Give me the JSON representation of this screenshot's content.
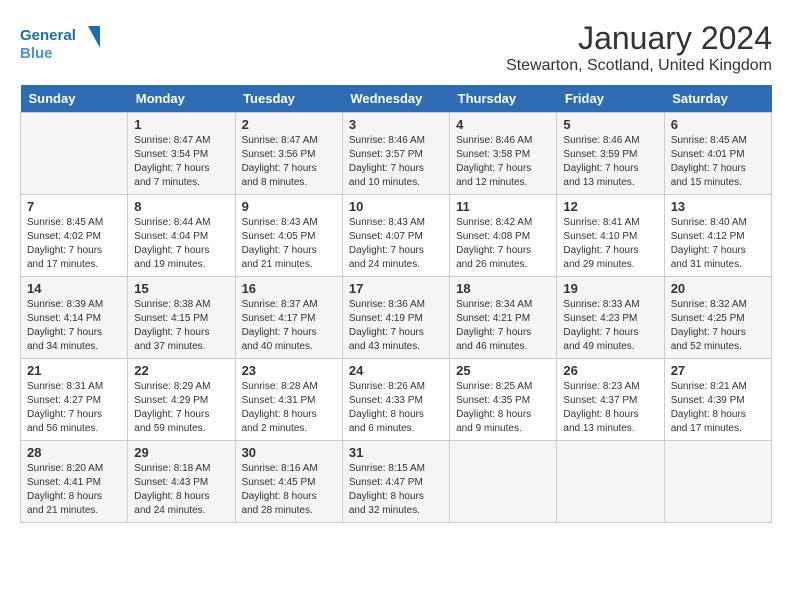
{
  "logo": {
    "line1": "General",
    "line2": "Blue"
  },
  "title": "January 2024",
  "location": "Stewarton, Scotland, United Kingdom",
  "days_of_week": [
    "Sunday",
    "Monday",
    "Tuesday",
    "Wednesday",
    "Thursday",
    "Friday",
    "Saturday"
  ],
  "weeks": [
    [
      {
        "day": "",
        "info": ""
      },
      {
        "day": "1",
        "info": "Sunrise: 8:47 AM\nSunset: 3:54 PM\nDaylight: 7 hours\nand 7 minutes."
      },
      {
        "day": "2",
        "info": "Sunrise: 8:47 AM\nSunset: 3:56 PM\nDaylight: 7 hours\nand 8 minutes."
      },
      {
        "day": "3",
        "info": "Sunrise: 8:46 AM\nSunset: 3:57 PM\nDaylight: 7 hours\nand 10 minutes."
      },
      {
        "day": "4",
        "info": "Sunrise: 8:46 AM\nSunset: 3:58 PM\nDaylight: 7 hours\nand 12 minutes."
      },
      {
        "day": "5",
        "info": "Sunrise: 8:46 AM\nSunset: 3:59 PM\nDaylight: 7 hours\nand 13 minutes."
      },
      {
        "day": "6",
        "info": "Sunrise: 8:45 AM\nSunset: 4:01 PM\nDaylight: 7 hours\nand 15 minutes."
      }
    ],
    [
      {
        "day": "7",
        "info": "Sunrise: 8:45 AM\nSunset: 4:02 PM\nDaylight: 7 hours\nand 17 minutes."
      },
      {
        "day": "8",
        "info": "Sunrise: 8:44 AM\nSunset: 4:04 PM\nDaylight: 7 hours\nand 19 minutes."
      },
      {
        "day": "9",
        "info": "Sunrise: 8:43 AM\nSunset: 4:05 PM\nDaylight: 7 hours\nand 21 minutes."
      },
      {
        "day": "10",
        "info": "Sunrise: 8:43 AM\nSunset: 4:07 PM\nDaylight: 7 hours\nand 24 minutes."
      },
      {
        "day": "11",
        "info": "Sunrise: 8:42 AM\nSunset: 4:08 PM\nDaylight: 7 hours\nand 26 minutes."
      },
      {
        "day": "12",
        "info": "Sunrise: 8:41 AM\nSunset: 4:10 PM\nDaylight: 7 hours\nand 29 minutes."
      },
      {
        "day": "13",
        "info": "Sunrise: 8:40 AM\nSunset: 4:12 PM\nDaylight: 7 hours\nand 31 minutes."
      }
    ],
    [
      {
        "day": "14",
        "info": "Sunrise: 8:39 AM\nSunset: 4:14 PM\nDaylight: 7 hours\nand 34 minutes."
      },
      {
        "day": "15",
        "info": "Sunrise: 8:38 AM\nSunset: 4:15 PM\nDaylight: 7 hours\nand 37 minutes."
      },
      {
        "day": "16",
        "info": "Sunrise: 8:37 AM\nSunset: 4:17 PM\nDaylight: 7 hours\nand 40 minutes."
      },
      {
        "day": "17",
        "info": "Sunrise: 8:36 AM\nSunset: 4:19 PM\nDaylight: 7 hours\nand 43 minutes."
      },
      {
        "day": "18",
        "info": "Sunrise: 8:34 AM\nSunset: 4:21 PM\nDaylight: 7 hours\nand 46 minutes."
      },
      {
        "day": "19",
        "info": "Sunrise: 8:33 AM\nSunset: 4:23 PM\nDaylight: 7 hours\nand 49 minutes."
      },
      {
        "day": "20",
        "info": "Sunrise: 8:32 AM\nSunset: 4:25 PM\nDaylight: 7 hours\nand 52 minutes."
      }
    ],
    [
      {
        "day": "21",
        "info": "Sunrise: 8:31 AM\nSunset: 4:27 PM\nDaylight: 7 hours\nand 56 minutes."
      },
      {
        "day": "22",
        "info": "Sunrise: 8:29 AM\nSunset: 4:29 PM\nDaylight: 7 hours\nand 59 minutes."
      },
      {
        "day": "23",
        "info": "Sunrise: 8:28 AM\nSunset: 4:31 PM\nDaylight: 8 hours\nand 2 minutes."
      },
      {
        "day": "24",
        "info": "Sunrise: 8:26 AM\nSunset: 4:33 PM\nDaylight: 8 hours\nand 6 minutes."
      },
      {
        "day": "25",
        "info": "Sunrise: 8:25 AM\nSunset: 4:35 PM\nDaylight: 8 hours\nand 9 minutes."
      },
      {
        "day": "26",
        "info": "Sunrise: 8:23 AM\nSunset: 4:37 PM\nDaylight: 8 hours\nand 13 minutes."
      },
      {
        "day": "27",
        "info": "Sunrise: 8:21 AM\nSunset: 4:39 PM\nDaylight: 8 hours\nand 17 minutes."
      }
    ],
    [
      {
        "day": "28",
        "info": "Sunrise: 8:20 AM\nSunset: 4:41 PM\nDaylight: 8 hours\nand 21 minutes."
      },
      {
        "day": "29",
        "info": "Sunrise: 8:18 AM\nSunset: 4:43 PM\nDaylight: 8 hours\nand 24 minutes."
      },
      {
        "day": "30",
        "info": "Sunrise: 8:16 AM\nSunset: 4:45 PM\nDaylight: 8 hours\nand 28 minutes."
      },
      {
        "day": "31",
        "info": "Sunrise: 8:15 AM\nSunset: 4:47 PM\nDaylight: 8 hours\nand 32 minutes."
      },
      {
        "day": "",
        "info": ""
      },
      {
        "day": "",
        "info": ""
      },
      {
        "day": "",
        "info": ""
      }
    ]
  ]
}
